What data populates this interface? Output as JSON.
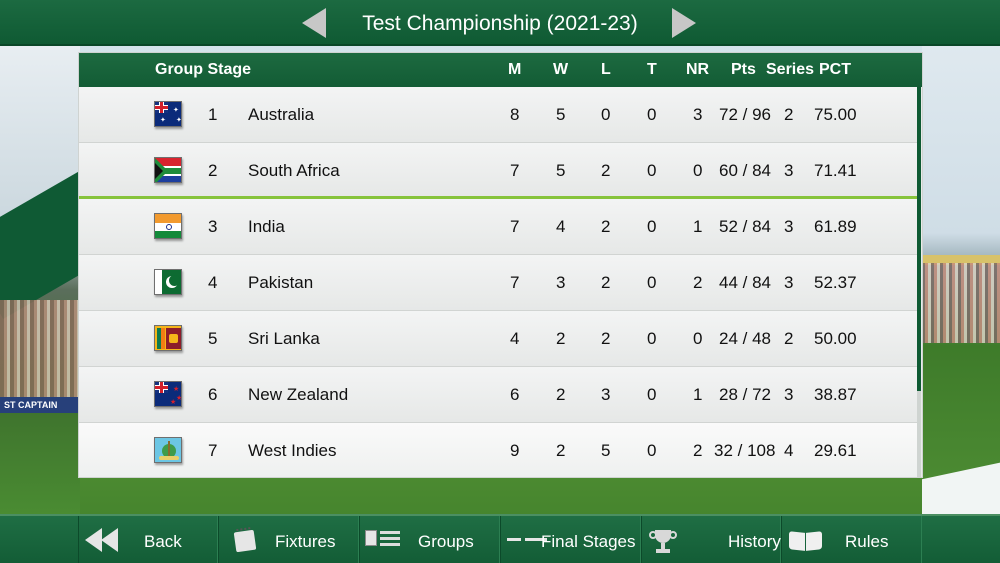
{
  "header": {
    "title": "Test Championship (2021-23)"
  },
  "table": {
    "columns": {
      "group": "Group Stage",
      "m": "M",
      "w": "W",
      "l": "L",
      "t": "T",
      "nr": "NR",
      "pts": "Pts",
      "series": "Series",
      "pct": "PCT"
    },
    "rows": [
      {
        "pos": "1",
        "team": "Australia",
        "flag": "australia-flag-icon",
        "m": "8",
        "w": "5",
        "l": "0",
        "t": "0",
        "nr": "3",
        "pts": "72 / 96",
        "series": "2",
        "pct": "75.00"
      },
      {
        "pos": "2",
        "team": "South Africa",
        "flag": "south-africa-flag-icon",
        "m": "7",
        "w": "5",
        "l": "2",
        "t": "0",
        "nr": "0",
        "pts": "60 / 84",
        "series": "3",
        "pct": "71.41"
      },
      {
        "pos": "3",
        "team": "India",
        "flag": "india-flag-icon",
        "m": "7",
        "w": "4",
        "l": "2",
        "t": "0",
        "nr": "1",
        "pts": "52 / 84",
        "series": "3",
        "pct": "61.89"
      },
      {
        "pos": "4",
        "team": "Pakistan",
        "flag": "pakistan-flag-icon",
        "m": "7",
        "w": "3",
        "l": "2",
        "t": "0",
        "nr": "2",
        "pts": "44 / 84",
        "series": "3",
        "pct": "52.37"
      },
      {
        "pos": "5",
        "team": "Sri Lanka",
        "flag": "sri-lanka-flag-icon",
        "m": "4",
        "w": "2",
        "l": "2",
        "t": "0",
        "nr": "0",
        "pts": "24 / 48",
        "series": "2",
        "pct": "50.00"
      },
      {
        "pos": "6",
        "team": "New Zealand",
        "flag": "new-zealand-flag-icon",
        "m": "6",
        "w": "2",
        "l": "3",
        "t": "0",
        "nr": "1",
        "pts": "28 / 72",
        "series": "3",
        "pct": "38.87"
      },
      {
        "pos": "7",
        "team": "West Indies",
        "flag": "west-indies-flag-icon",
        "m": "9",
        "w": "2",
        "l": "5",
        "t": "0",
        "nr": "2",
        "pts": "32 / 108",
        "series": "4",
        "pct": "29.61"
      }
    ]
  },
  "background": {
    "sign_text": "ST CAPTAIN"
  },
  "nav": {
    "back": "Back",
    "fixtures": "Fixtures",
    "groups": "Groups",
    "final_stages": "Final Stages",
    "history": "History",
    "rules": "Rules"
  },
  "colors": {
    "header_green": "#135c35",
    "qualify_line": "#86c33b",
    "row_bg": "#e9ebea"
  }
}
